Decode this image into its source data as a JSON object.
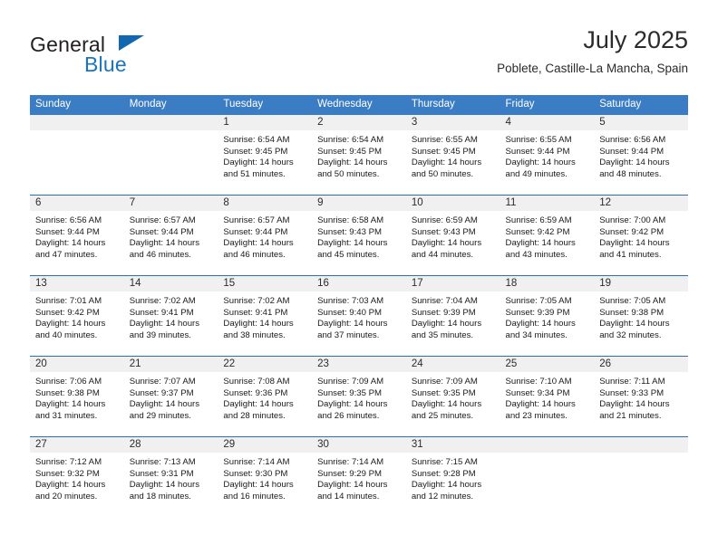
{
  "brand": {
    "word1": "General",
    "word2": "Blue",
    "triangle_color": "#1267b1",
    "blue_color": "#1b75bb"
  },
  "header": {
    "month_title": "July 2025",
    "location": "Poblete, Castille-La Mancha, Spain"
  },
  "calendar": {
    "accent_color": "#3b7dc4",
    "weekday_headers": [
      "Sunday",
      "Monday",
      "Tuesday",
      "Wednesday",
      "Thursday",
      "Friday",
      "Saturday"
    ],
    "weeks": [
      [
        {
          "day": "",
          "sunrise": "",
          "sunset": "",
          "daylight1": "",
          "daylight2": ""
        },
        {
          "day": "",
          "sunrise": "",
          "sunset": "",
          "daylight1": "",
          "daylight2": ""
        },
        {
          "day": "1",
          "sunrise": "Sunrise: 6:54 AM",
          "sunset": "Sunset: 9:45 PM",
          "daylight1": "Daylight: 14 hours",
          "daylight2": "and 51 minutes."
        },
        {
          "day": "2",
          "sunrise": "Sunrise: 6:54 AM",
          "sunset": "Sunset: 9:45 PM",
          "daylight1": "Daylight: 14 hours",
          "daylight2": "and 50 minutes."
        },
        {
          "day": "3",
          "sunrise": "Sunrise: 6:55 AM",
          "sunset": "Sunset: 9:45 PM",
          "daylight1": "Daylight: 14 hours",
          "daylight2": "and 50 minutes."
        },
        {
          "day": "4",
          "sunrise": "Sunrise: 6:55 AM",
          "sunset": "Sunset: 9:44 PM",
          "daylight1": "Daylight: 14 hours",
          "daylight2": "and 49 minutes."
        },
        {
          "day": "5",
          "sunrise": "Sunrise: 6:56 AM",
          "sunset": "Sunset: 9:44 PM",
          "daylight1": "Daylight: 14 hours",
          "daylight2": "and 48 minutes."
        }
      ],
      [
        {
          "day": "6",
          "sunrise": "Sunrise: 6:56 AM",
          "sunset": "Sunset: 9:44 PM",
          "daylight1": "Daylight: 14 hours",
          "daylight2": "and 47 minutes."
        },
        {
          "day": "7",
          "sunrise": "Sunrise: 6:57 AM",
          "sunset": "Sunset: 9:44 PM",
          "daylight1": "Daylight: 14 hours",
          "daylight2": "and 46 minutes."
        },
        {
          "day": "8",
          "sunrise": "Sunrise: 6:57 AM",
          "sunset": "Sunset: 9:44 PM",
          "daylight1": "Daylight: 14 hours",
          "daylight2": "and 46 minutes."
        },
        {
          "day": "9",
          "sunrise": "Sunrise: 6:58 AM",
          "sunset": "Sunset: 9:43 PM",
          "daylight1": "Daylight: 14 hours",
          "daylight2": "and 45 minutes."
        },
        {
          "day": "10",
          "sunrise": "Sunrise: 6:59 AM",
          "sunset": "Sunset: 9:43 PM",
          "daylight1": "Daylight: 14 hours",
          "daylight2": "and 44 minutes."
        },
        {
          "day": "11",
          "sunrise": "Sunrise: 6:59 AM",
          "sunset": "Sunset: 9:42 PM",
          "daylight1": "Daylight: 14 hours",
          "daylight2": "and 43 minutes."
        },
        {
          "day": "12",
          "sunrise": "Sunrise: 7:00 AM",
          "sunset": "Sunset: 9:42 PM",
          "daylight1": "Daylight: 14 hours",
          "daylight2": "and 41 minutes."
        }
      ],
      [
        {
          "day": "13",
          "sunrise": "Sunrise: 7:01 AM",
          "sunset": "Sunset: 9:42 PM",
          "daylight1": "Daylight: 14 hours",
          "daylight2": "and 40 minutes."
        },
        {
          "day": "14",
          "sunrise": "Sunrise: 7:02 AM",
          "sunset": "Sunset: 9:41 PM",
          "daylight1": "Daylight: 14 hours",
          "daylight2": "and 39 minutes."
        },
        {
          "day": "15",
          "sunrise": "Sunrise: 7:02 AM",
          "sunset": "Sunset: 9:41 PM",
          "daylight1": "Daylight: 14 hours",
          "daylight2": "and 38 minutes."
        },
        {
          "day": "16",
          "sunrise": "Sunrise: 7:03 AM",
          "sunset": "Sunset: 9:40 PM",
          "daylight1": "Daylight: 14 hours",
          "daylight2": "and 37 minutes."
        },
        {
          "day": "17",
          "sunrise": "Sunrise: 7:04 AM",
          "sunset": "Sunset: 9:39 PM",
          "daylight1": "Daylight: 14 hours",
          "daylight2": "and 35 minutes."
        },
        {
          "day": "18",
          "sunrise": "Sunrise: 7:05 AM",
          "sunset": "Sunset: 9:39 PM",
          "daylight1": "Daylight: 14 hours",
          "daylight2": "and 34 minutes."
        },
        {
          "day": "19",
          "sunrise": "Sunrise: 7:05 AM",
          "sunset": "Sunset: 9:38 PM",
          "daylight1": "Daylight: 14 hours",
          "daylight2": "and 32 minutes."
        }
      ],
      [
        {
          "day": "20",
          "sunrise": "Sunrise: 7:06 AM",
          "sunset": "Sunset: 9:38 PM",
          "daylight1": "Daylight: 14 hours",
          "daylight2": "and 31 minutes."
        },
        {
          "day": "21",
          "sunrise": "Sunrise: 7:07 AM",
          "sunset": "Sunset: 9:37 PM",
          "daylight1": "Daylight: 14 hours",
          "daylight2": "and 29 minutes."
        },
        {
          "day": "22",
          "sunrise": "Sunrise: 7:08 AM",
          "sunset": "Sunset: 9:36 PM",
          "daylight1": "Daylight: 14 hours",
          "daylight2": "and 28 minutes."
        },
        {
          "day": "23",
          "sunrise": "Sunrise: 7:09 AM",
          "sunset": "Sunset: 9:35 PM",
          "daylight1": "Daylight: 14 hours",
          "daylight2": "and 26 minutes."
        },
        {
          "day": "24",
          "sunrise": "Sunrise: 7:09 AM",
          "sunset": "Sunset: 9:35 PM",
          "daylight1": "Daylight: 14 hours",
          "daylight2": "and 25 minutes."
        },
        {
          "day": "25",
          "sunrise": "Sunrise: 7:10 AM",
          "sunset": "Sunset: 9:34 PM",
          "daylight1": "Daylight: 14 hours",
          "daylight2": "and 23 minutes."
        },
        {
          "day": "26",
          "sunrise": "Sunrise: 7:11 AM",
          "sunset": "Sunset: 9:33 PM",
          "daylight1": "Daylight: 14 hours",
          "daylight2": "and 21 minutes."
        }
      ],
      [
        {
          "day": "27",
          "sunrise": "Sunrise: 7:12 AM",
          "sunset": "Sunset: 9:32 PM",
          "daylight1": "Daylight: 14 hours",
          "daylight2": "and 20 minutes."
        },
        {
          "day": "28",
          "sunrise": "Sunrise: 7:13 AM",
          "sunset": "Sunset: 9:31 PM",
          "daylight1": "Daylight: 14 hours",
          "daylight2": "and 18 minutes."
        },
        {
          "day": "29",
          "sunrise": "Sunrise: 7:14 AM",
          "sunset": "Sunset: 9:30 PM",
          "daylight1": "Daylight: 14 hours",
          "daylight2": "and 16 minutes."
        },
        {
          "day": "30",
          "sunrise": "Sunrise: 7:14 AM",
          "sunset": "Sunset: 9:29 PM",
          "daylight1": "Daylight: 14 hours",
          "daylight2": "and 14 minutes."
        },
        {
          "day": "31",
          "sunrise": "Sunrise: 7:15 AM",
          "sunset": "Sunset: 9:28 PM",
          "daylight1": "Daylight: 14 hours",
          "daylight2": "and 12 minutes."
        },
        {
          "day": "",
          "sunrise": "",
          "sunset": "",
          "daylight1": "",
          "daylight2": ""
        },
        {
          "day": "",
          "sunrise": "",
          "sunset": "",
          "daylight1": "",
          "daylight2": ""
        }
      ]
    ]
  }
}
